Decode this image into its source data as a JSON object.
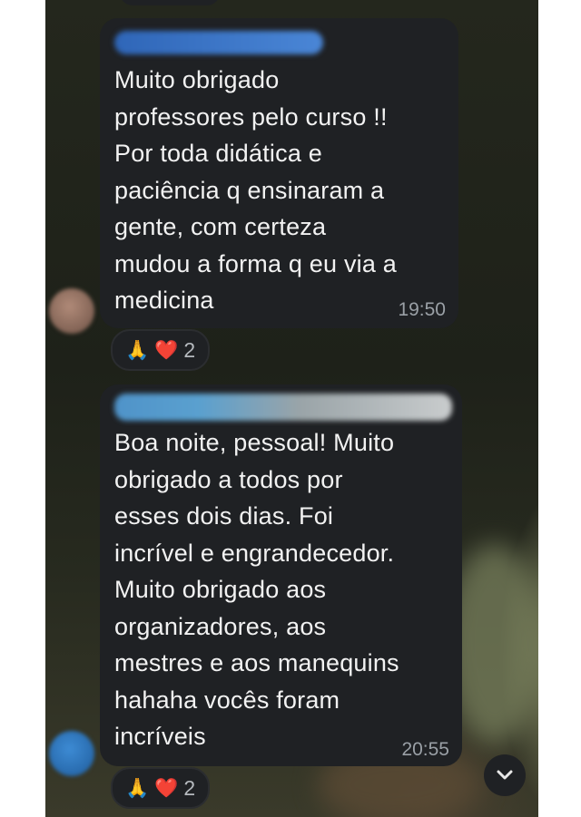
{
  "messages": [
    {
      "lines": [
        "Muito obrigado",
        "professores pelo curso !!",
        "Por toda didática e",
        "paciência q ensinaram a",
        "gente, com certeza",
        "mudou a forma q eu via a",
        "medicina"
      ],
      "time": "19:50",
      "reactions": {
        "emojis": [
          "🙏",
          "❤️"
        ],
        "count": "2"
      }
    },
    {
      "lines": [
        "Boa noite, pessoal! Muito",
        "obrigado a todos por",
        "esses dois dias. Foi",
        "incrível e engrandecedor.",
        "Muito obrigado aos",
        "organizadores, aos",
        "mestres e aos manequins",
        "hahaha vocês foram",
        "incríveis"
      ],
      "time": "20:55",
      "reactions": {
        "emojis": [
          "🙏",
          "❤️"
        ],
        "count": "2"
      }
    }
  ],
  "colors": {
    "bubble": "#1f2124",
    "text": "#f2f2f2",
    "timestamp": "#9aa0a6",
    "sender_blur_1": "#3b74c9",
    "sender_blur_2": "#5a9ad0",
    "heart": "#e0223a"
  },
  "icons": {
    "scroll_down": "chevron-down-icon"
  },
  "scroll_down_glyph": "⌄"
}
